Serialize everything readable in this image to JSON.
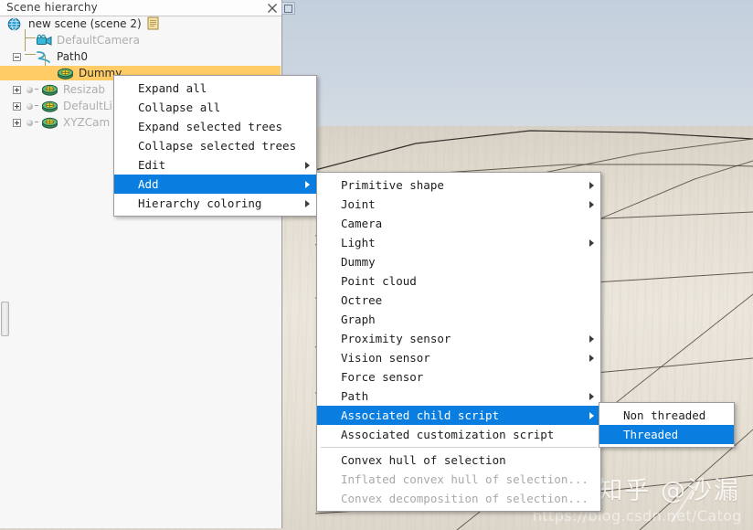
{
  "window": {
    "title": "Scene hierarchy",
    "close_icon": "close-icon",
    "maximize_icon": "maximize-icon"
  },
  "hierarchy": {
    "nodes": [
      {
        "label": "new scene (scene 2)",
        "icon": "globe-icon",
        "depth": 0,
        "state": "normal",
        "expander": "none",
        "badge": "script-icon"
      },
      {
        "label": "DefaultCamera",
        "icon": "camera-icon",
        "depth": 2,
        "state": "disabled",
        "expander": "none",
        "badge": ""
      },
      {
        "label": "Path0",
        "icon": "path-icon",
        "depth": 1,
        "state": "normal",
        "expander": "minus",
        "badge": ""
      },
      {
        "label": "Dummy",
        "icon": "dummy-icon",
        "depth": 2,
        "state": "selected",
        "expander": "none",
        "badge": ""
      },
      {
        "label": "Resizab",
        "icon": "dummy-icon",
        "depth": 1,
        "state": "disabled",
        "expander": "plus",
        "badge": ""
      },
      {
        "label": "DefaultLi",
        "icon": "dummy-icon",
        "depth": 1,
        "state": "disabled",
        "expander": "plus",
        "badge": ""
      },
      {
        "label": "XYZCam",
        "icon": "dummy-icon",
        "depth": 1,
        "state": "disabled",
        "expander": "plus",
        "badge": ""
      }
    ]
  },
  "context_menu": {
    "items": [
      {
        "label": "Expand all",
        "submenu": false,
        "highlighted": false,
        "disabled": false,
        "separator_after": false
      },
      {
        "label": "Collapse all",
        "submenu": false,
        "highlighted": false,
        "disabled": false,
        "separator_after": false
      },
      {
        "label": "Expand selected trees",
        "submenu": false,
        "highlighted": false,
        "disabled": false,
        "separator_after": false
      },
      {
        "label": "Collapse selected trees",
        "submenu": false,
        "highlighted": false,
        "disabled": false,
        "separator_after": false
      },
      {
        "label": "Edit",
        "submenu": true,
        "highlighted": false,
        "disabled": false,
        "separator_after": false
      },
      {
        "label": "Add",
        "submenu": true,
        "highlighted": true,
        "disabled": false,
        "separator_after": false
      },
      {
        "label": "Hierarchy coloring",
        "submenu": true,
        "highlighted": false,
        "disabled": false,
        "separator_after": false
      }
    ]
  },
  "add_submenu": {
    "items": [
      {
        "label": "Primitive shape",
        "submenu": true,
        "highlighted": false,
        "disabled": false,
        "separator_after": false
      },
      {
        "label": "Joint",
        "submenu": true,
        "highlighted": false,
        "disabled": false,
        "separator_after": false
      },
      {
        "label": "Camera",
        "submenu": false,
        "highlighted": false,
        "disabled": false,
        "separator_after": false
      },
      {
        "label": "Light",
        "submenu": true,
        "highlighted": false,
        "disabled": false,
        "separator_after": false
      },
      {
        "label": "Dummy",
        "submenu": false,
        "highlighted": false,
        "disabled": false,
        "separator_after": false
      },
      {
        "label": "Point cloud",
        "submenu": false,
        "highlighted": false,
        "disabled": false,
        "separator_after": false
      },
      {
        "label": "Octree",
        "submenu": false,
        "highlighted": false,
        "disabled": false,
        "separator_after": false
      },
      {
        "label": "Graph",
        "submenu": false,
        "highlighted": false,
        "disabled": false,
        "separator_after": false
      },
      {
        "label": "Proximity sensor",
        "submenu": true,
        "highlighted": false,
        "disabled": false,
        "separator_after": false
      },
      {
        "label": "Vision sensor",
        "submenu": true,
        "highlighted": false,
        "disabled": false,
        "separator_after": false
      },
      {
        "label": "Force sensor",
        "submenu": false,
        "highlighted": false,
        "disabled": false,
        "separator_after": false
      },
      {
        "label": "Path",
        "submenu": true,
        "highlighted": false,
        "disabled": false,
        "separator_after": false
      },
      {
        "label": "Associated child script",
        "submenu": true,
        "highlighted": true,
        "disabled": false,
        "separator_after": false
      },
      {
        "label": "Associated customization script",
        "submenu": false,
        "highlighted": false,
        "disabled": false,
        "separator_after": true
      },
      {
        "label": "Convex hull of selection",
        "submenu": false,
        "highlighted": false,
        "disabled": false,
        "separator_after": false
      },
      {
        "label": "Inflated convex hull of selection...",
        "submenu": false,
        "highlighted": false,
        "disabled": true,
        "separator_after": false
      },
      {
        "label": "Convex decomposition of selection...",
        "submenu": false,
        "highlighted": false,
        "disabled": true,
        "separator_after": false
      }
    ]
  },
  "script_submenu": {
    "items": [
      {
        "label": "Non threaded",
        "submenu": false,
        "highlighted": false,
        "disabled": false,
        "separator_after": false
      },
      {
        "label": "Threaded",
        "submenu": false,
        "highlighted": true,
        "disabled": false,
        "separator_after": false
      }
    ]
  },
  "watermarks": {
    "brand": "知乎 @沙漏",
    "url": "https://blog.csdn.net/Catog"
  },
  "colors": {
    "highlight": "#0a7ee0",
    "selection": "#ffcc66",
    "sky": "#c9d3de",
    "floor": "#e7e1d6"
  }
}
